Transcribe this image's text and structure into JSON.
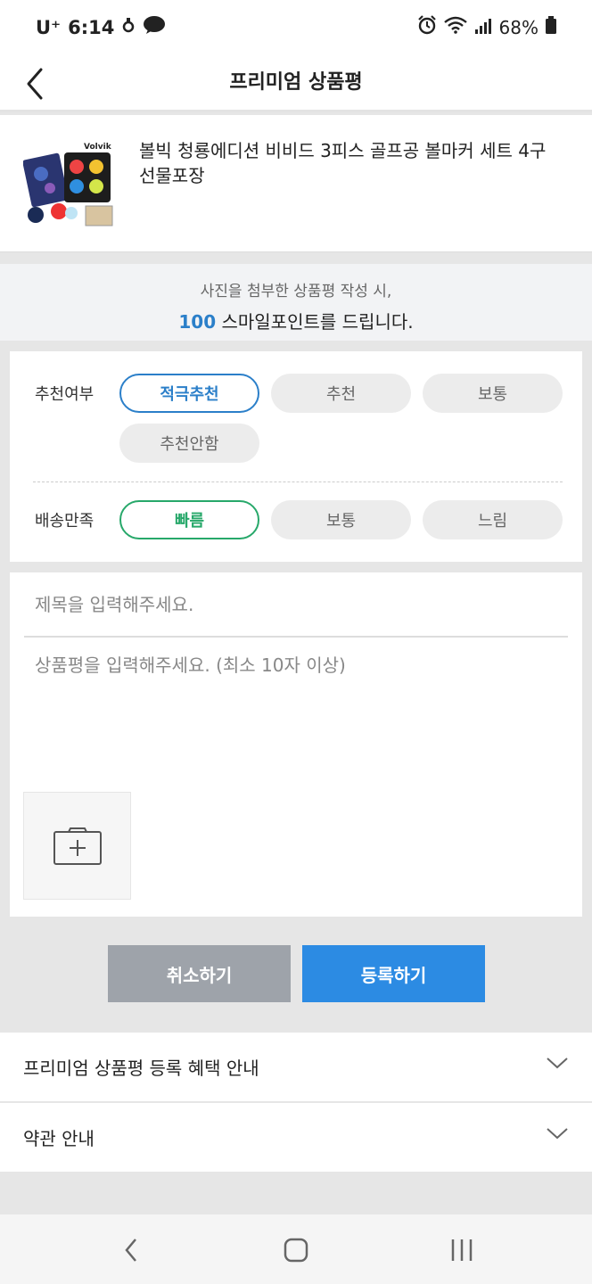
{
  "status_bar": {
    "carrier": "U⁺",
    "time": "6:14",
    "battery": "68%",
    "icons": [
      "alarm-icon",
      "wifi-icon",
      "signal-icon",
      "battery-icon"
    ]
  },
  "header": {
    "title": "프리미엄 상품평",
    "back_icon": "chevron-left-icon"
  },
  "product": {
    "name": "볼빅 청룡에디션 비비드 3피스 골프공 볼마커 세트 4구 선물포장",
    "brand_on_image": "Volvik"
  },
  "promo": {
    "line1": "사진을 첨부한 상품평 작성 시,",
    "points": "100",
    "line2_rest": " 스마일포인트를 드립니다."
  },
  "rating": {
    "recommend_label": "추천여부",
    "recommend_options": [
      "적극추천",
      "추천",
      "보통",
      "추천안함"
    ],
    "recommend_selected": "적극추천",
    "delivery_label": "배송만족",
    "delivery_options": [
      "빠름",
      "보통",
      "느림"
    ],
    "delivery_selected": "빠름"
  },
  "form": {
    "title_placeholder": "제목을 입력해주세요.",
    "body_placeholder": "상품평을 입력해주세요. (최소 10자 이상)",
    "photo_icon": "camera-plus-icon"
  },
  "buttons": {
    "cancel": "취소하기",
    "submit": "등록하기"
  },
  "accordions": [
    {
      "label": "프리미엄 상품평 등록 혜택 안내",
      "icon": "chevron-down-icon"
    },
    {
      "label": "약관 안내",
      "icon": "chevron-down-icon"
    }
  ],
  "nav": {
    "icons": [
      "nav-back-icon",
      "nav-home-icon",
      "nav-recents-icon"
    ]
  },
  "colors": {
    "accent_blue": "#2b7fc9",
    "accent_green": "#27a86a",
    "submit_blue": "#2c8be3",
    "cancel_gray": "#9ea3aa"
  }
}
